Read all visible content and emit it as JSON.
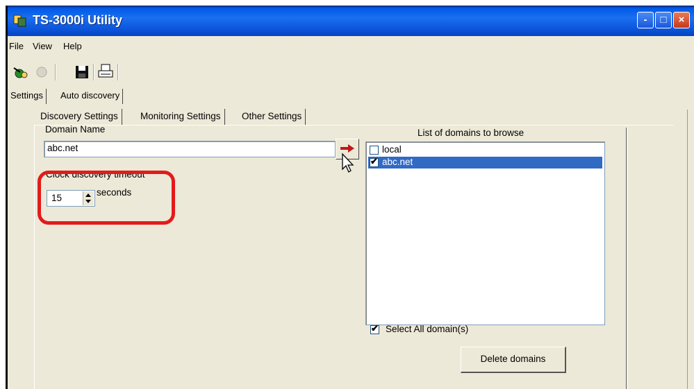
{
  "window": {
    "title": "TS-3000i Utility"
  },
  "titlebar_buttons": {
    "minimize": "-",
    "maximize": "□",
    "close": "×"
  },
  "menu": {
    "items": [
      "File",
      "View",
      "Help"
    ]
  },
  "toolbar": {
    "icons": [
      "discovery-icon",
      "disabled-icon",
      "save-icon",
      "print-icon"
    ]
  },
  "tabs": {
    "outer": [
      "Settings",
      "Auto discovery"
    ],
    "inner": [
      "Discovery Settings",
      "Monitoring Settings",
      "Other Settings"
    ]
  },
  "discovery": {
    "domain_label": "Domain Name",
    "domain_value": "abc.net",
    "timeout_label": "Clock discovery timeout",
    "timeout_value": "15",
    "timeout_unit": "seconds"
  },
  "domain_list": {
    "title": "List of domains to browse",
    "items": [
      {
        "label": "local",
        "checked": false,
        "selected": false
      },
      {
        "label": "abc.net",
        "checked": true,
        "selected": true
      }
    ],
    "select_all_label": "Select All domain(s)",
    "select_all_checked": true,
    "delete_label": "Delete domains",
    "check_mark": "✔"
  },
  "colors": {
    "title_bar": "#0b53d8",
    "selection": "#316ac5",
    "highlight": "#e31b1b",
    "face": "#ece9d8"
  }
}
